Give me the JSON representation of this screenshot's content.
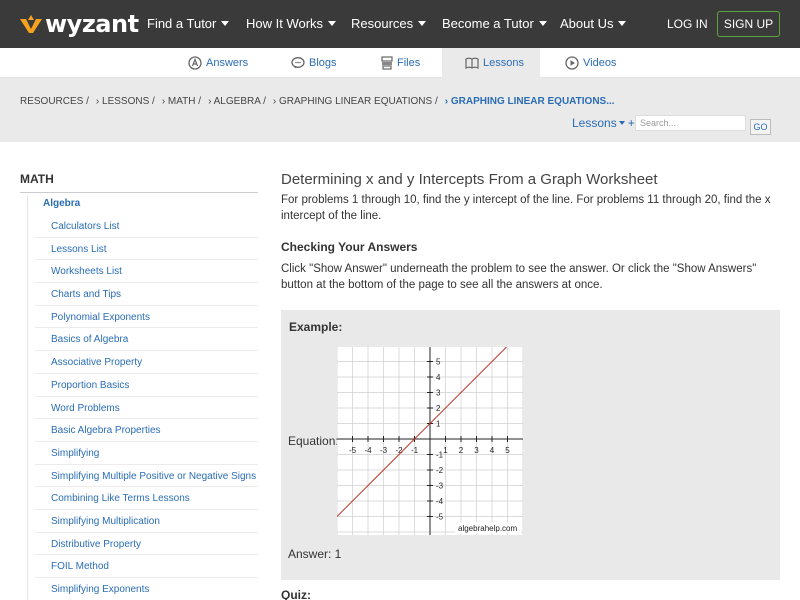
{
  "brand": {
    "name": "wyzant",
    "accent": "#f6a21e",
    "nav_bg": "#3a3a3a",
    "link": "#2a6db5",
    "signup_border": "#5aa43f"
  },
  "nav": {
    "items": [
      "Find a Tutor",
      "How It Works",
      "Resources",
      "Become a Tutor",
      "About Us"
    ],
    "login": "LOG IN",
    "signup": "SIGN UP"
  },
  "tabs": [
    {
      "label": "Answers",
      "icon": "answers-icon"
    },
    {
      "label": "Blogs",
      "icon": "blogs-icon"
    },
    {
      "label": "Files",
      "icon": "files-icon"
    },
    {
      "label": "Lessons",
      "icon": "lessons-icon",
      "active": true
    },
    {
      "label": "Videos",
      "icon": "videos-icon"
    }
  ],
  "breadcrumb": [
    "RESOURCES /",
    "› LESSONS /",
    "› MATH /",
    "› ALGEBRA /",
    "› GRAPHING LINEAR EQUATIONS /",
    "› GRAPHING LINEAR EQUATIONS..."
  ],
  "search": {
    "scope": "Lessons",
    "plus": "+",
    "placeholder": "Search...",
    "go": "GO"
  },
  "sidebar": {
    "title": "MATH",
    "section": "Algebra",
    "items": [
      "Calculators List",
      "Lessons List",
      "Worksheets List",
      "Charts and Tips",
      "Polynomial Exponents",
      "Basics of Algebra",
      "Associative Property",
      "Proportion Basics",
      "Word Problems",
      "Basic Algebra Properties",
      "Simplifying",
      "Simplifying Multiple Positive or Negative Signs",
      "Combining Like Terms Lessons",
      "Simplifying Multiplication",
      "Distributive Property",
      "FOIL Method",
      "Simplifying Exponents"
    ]
  },
  "main": {
    "title": "Determining x and y Intercepts From a Graph Worksheet",
    "intro": "For problems 1 through 10, find the y intercept of the line. For problems 11 through 20, find the x intercept of the line.",
    "checking_heading": "Checking Your Answers",
    "checking_text": "Click \"Show Answer\" underneath the problem to see the answer. Or click the \"Show Answers\" button at the bottom of the page to see all the answers at once.",
    "example_label": "Example:",
    "equation_label": "Equation:",
    "answer_label": "Answer: 1",
    "quiz_label": "Quiz:"
  },
  "graph": {
    "x_ticks": [
      "-5",
      "-4",
      "-3",
      "-2",
      "-1",
      "1",
      "2",
      "3",
      "4",
      "5"
    ],
    "y_ticks": [
      "5",
      "4",
      "3",
      "2",
      "1",
      "-1",
      "-2",
      "-3",
      "-4",
      "-5"
    ],
    "watermark": "algebrahelp.com",
    "line_color": "#c0392b",
    "xlim": [
      -6,
      6
    ],
    "ylim": [
      -6,
      6
    ],
    "line": {
      "slope": 1,
      "intercept": 1
    }
  }
}
